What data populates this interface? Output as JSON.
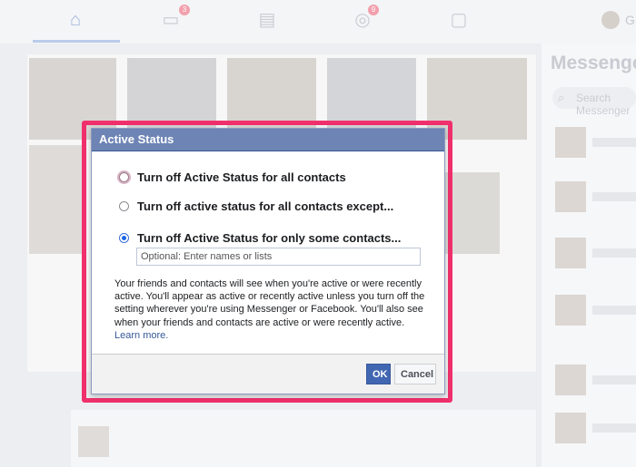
{
  "nav": {
    "video_badge": "3",
    "groups_badge": "9",
    "profile_initial": "G"
  },
  "messenger": {
    "title": "Messenger",
    "search_placeholder": "Search Messenger"
  },
  "dialog": {
    "title": "Active Status",
    "options": [
      {
        "label": "Turn off Active Status for all contacts",
        "checked": false
      },
      {
        "label": "Turn off active status for all contacts except...",
        "checked": false
      },
      {
        "label": "Turn off Active Status for only some contacts...",
        "checked": true
      }
    ],
    "names_placeholder": "Optional: Enter names or lists",
    "description": "Your friends and contacts will see when you're active or were recently active. You'll appear as active or recently active unless you turn off the setting wherever you're using Messenger or Facebook. You'll also see when your friends and contacts are active or were recently active.",
    "learn_more": "Learn more.",
    "ok_label": "OK",
    "cancel_label": "Cancel"
  },
  "colors": {
    "highlight": "#f0306c",
    "header": "#6d84b4",
    "ok_button": "#4267b2"
  }
}
